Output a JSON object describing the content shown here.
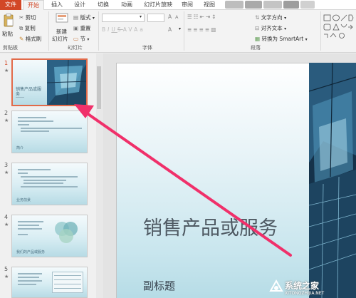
{
  "tabs": [
    "文件",
    "开始",
    "插入",
    "设计",
    "切换",
    "动画",
    "幻灯片放映",
    "审阅",
    "视图"
  ],
  "clipboard": {
    "paste": "粘贴",
    "cut": "剪切",
    "copy": "复制",
    "format_painter": "格式刷",
    "group": "剪贴板"
  },
  "slides_group": {
    "new_slide_line1": "新建",
    "new_slide_line2": "幻灯片",
    "layout": "版式",
    "reset": "重置",
    "section": "节",
    "group": "幻灯片"
  },
  "font_group": {
    "group": "字体"
  },
  "paragraph_group": {
    "text_direction": "文字方向",
    "align_text": "对齐文本",
    "smartart": "转换为 SmartArt",
    "group": "段落"
  },
  "thumbnails": [
    {
      "number": "1",
      "title_line1": "销售产品或服",
      "title_line2": "务"
    },
    {
      "number": "2",
      "title": "简介"
    },
    {
      "number": "3",
      "title": "业务前景"
    },
    {
      "number": "4",
      "title": "我们的产品或服务"
    },
    {
      "number": "5"
    }
  ],
  "slide": {
    "title": "销售产品或服务",
    "subtitle": "副标题"
  },
  "watermark": {
    "brand": "系统之家",
    "url": "XITONGZHIJIA.NET"
  },
  "colors": {
    "accent": "#d24726",
    "arrow": "#f0306a"
  }
}
